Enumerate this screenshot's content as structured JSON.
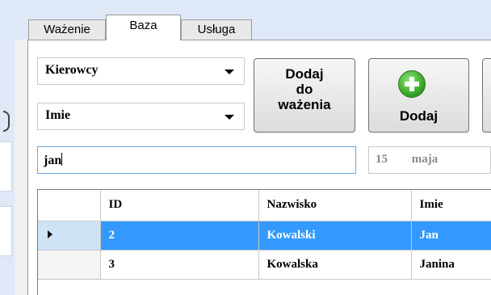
{
  "tabs": [
    "Ważenie",
    "Baza",
    "Usługa"
  ],
  "combo_table": "Kierowcy",
  "combo_field": "Imie",
  "buttons": {
    "add_to_weighing": [
      "Dodaj",
      "do",
      "ważenia"
    ],
    "add": "Dodaj"
  },
  "search": {
    "value": "jan"
  },
  "date": {
    "day": "15",
    "month": "maja"
  },
  "grid": {
    "headers": [
      "ID",
      "Nazwisko",
      "Imie"
    ],
    "rows": [
      {
        "id": "2",
        "nazwisko": "Kowalski",
        "imie": "Jan",
        "selected": true
      },
      {
        "id": "3",
        "nazwisko": "Kowalska",
        "imie": "Janina",
        "selected": false
      }
    ]
  },
  "colors": {
    "selection": "#3399ff",
    "tab_strip": "#dfe8f6",
    "add_icon": "#2e9e1e"
  }
}
